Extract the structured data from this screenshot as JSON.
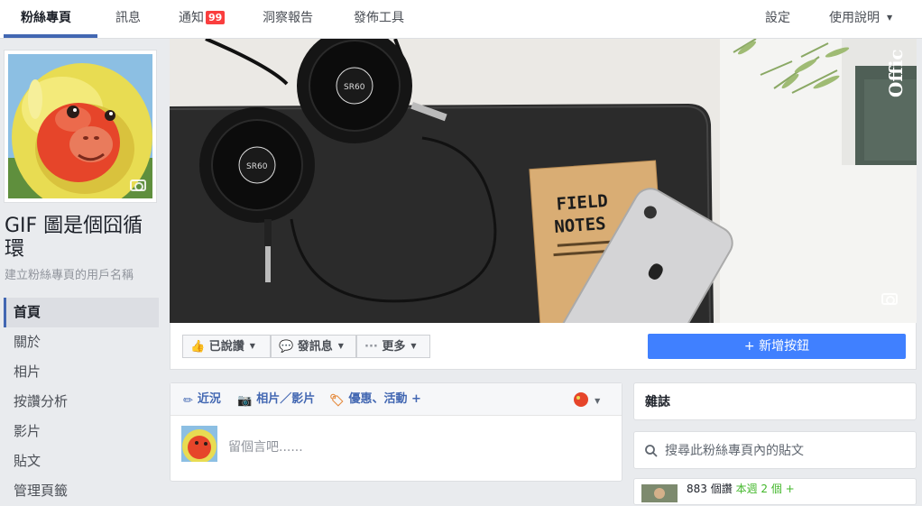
{
  "topnav": {
    "tabs": [
      "粉絲專頁",
      "訊息",
      "通知",
      "洞察報告",
      "發佈工具"
    ],
    "notification_count": "99",
    "settings": "設定",
    "help": "使用說明"
  },
  "page": {
    "name": "GIF 圖是個囧循環",
    "username_link": "建立粉絲專頁的用戶名稱"
  },
  "leftnav": [
    "首頁",
    "關於",
    "相片",
    "按讚分析",
    "影片",
    "貼文",
    "管理頁籤"
  ],
  "cover": {
    "field_notes_line1": "FIELD",
    "field_notes_line2": "NOTES",
    "headphone_label_1": "SR60",
    "headphone_label_2": "SR60",
    "corner_text": "Offic"
  },
  "actions": {
    "liked": "已說讚",
    "message": "發訊息",
    "more": "更多",
    "add_button": "+ 新增按鈕"
  },
  "composer": {
    "tabs": [
      "近況",
      "相片／影片",
      "優惠、活動 +"
    ],
    "placeholder": "留個言吧......"
  },
  "sidebar": {
    "notes_title": "雜誌",
    "search_placeholder": "搜尋此粉絲專頁內的貼文",
    "likes_count": "883 個讚",
    "likes_week": "本週 2 個 +"
  },
  "colors": {
    "accent": "#4267b2",
    "primary_button": "#4080ff",
    "badge": "#fa3e3e"
  }
}
